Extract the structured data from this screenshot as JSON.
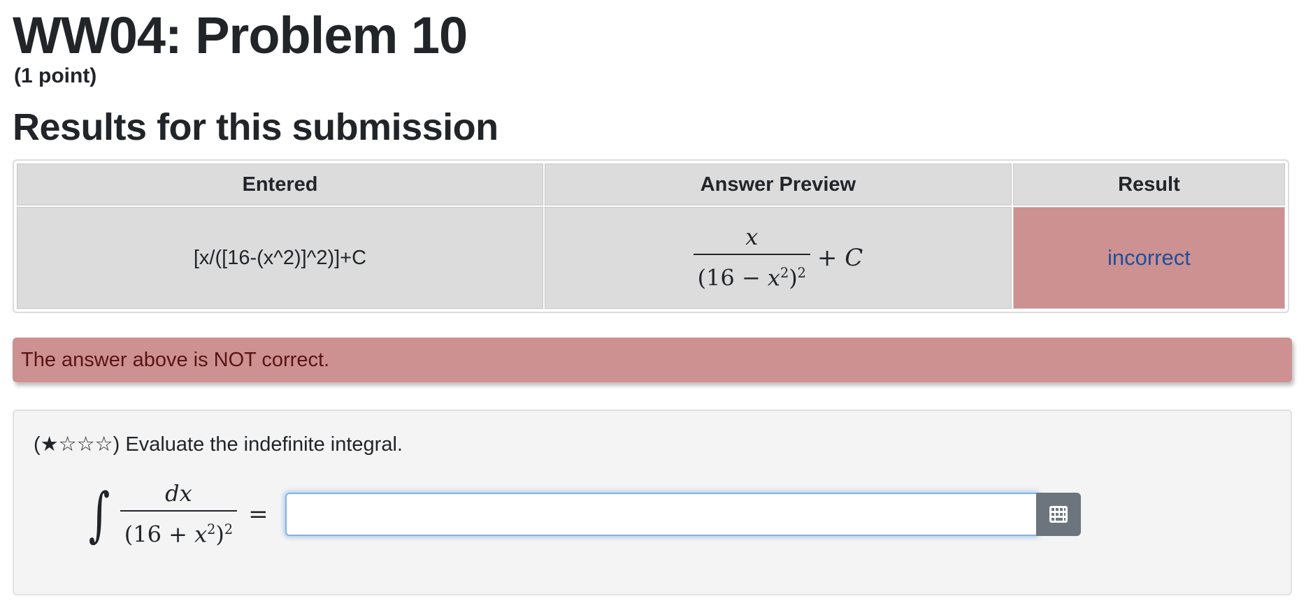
{
  "header": {
    "title": "WW04: Problem 10",
    "points": "(1 point)"
  },
  "results": {
    "heading": "Results for this submission",
    "columns": [
      "Entered",
      "Answer Preview",
      "Result"
    ],
    "row": {
      "entered": "[x/([16-(x^2)]^2)]+C",
      "preview": {
        "numerator": "x",
        "denominator_open": "(16 − ",
        "denominator_var": "x",
        "denominator_inner_exp": "2",
        "denominator_close": ")",
        "denominator_outer_exp": "2",
        "plus": "+ ",
        "constant": "C"
      },
      "result": "incorrect"
    },
    "result_color": "#cd9192"
  },
  "alert": {
    "message": "The answer above is NOT correct."
  },
  "problem": {
    "stars": "(★☆☆☆)",
    "prompt": "Evaluate the indefinite integral.",
    "integral": {
      "sign": "∫",
      "numerator": "dx",
      "denominator_open": "(16 + ",
      "denominator_var": "x",
      "denominator_inner_exp": "2",
      "denominator_close": ")",
      "denominator_outer_exp": "2",
      "equals": "="
    },
    "answer_value": "",
    "answer_placeholder": "",
    "equation_editor_icon": "grid-icon"
  }
}
